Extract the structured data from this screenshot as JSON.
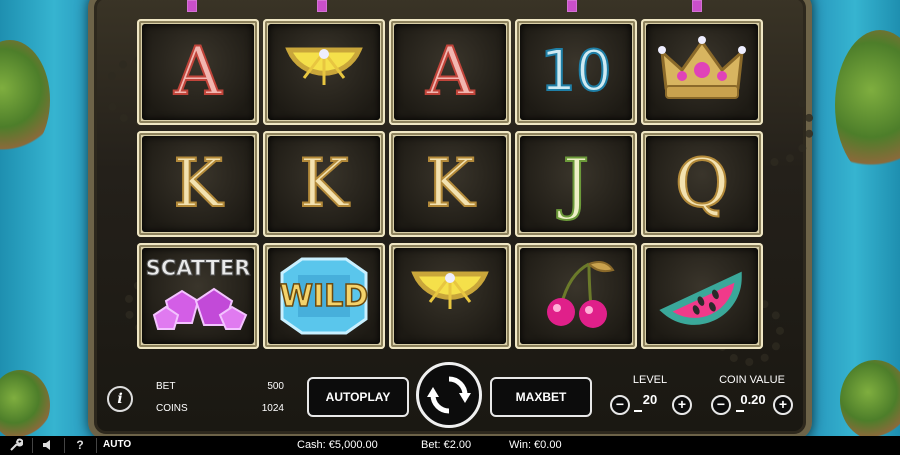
{
  "reels": [
    [
      {
        "symbol": "A",
        "style": "red"
      },
      {
        "symbol": "K",
        "style": "gold"
      },
      {
        "symbol": "SCATTER",
        "style": "scatter"
      }
    ],
    [
      {
        "symbol": "lemon",
        "style": "lemon"
      },
      {
        "symbol": "K",
        "style": "gold"
      },
      {
        "symbol": "WILD",
        "style": "wild"
      }
    ],
    [
      {
        "symbol": "A",
        "style": "red"
      },
      {
        "symbol": "K",
        "style": "gold"
      },
      {
        "symbol": "lemon",
        "style": "lemon"
      }
    ],
    [
      {
        "symbol": "10",
        "style": "blue"
      },
      {
        "symbol": "J",
        "style": "green"
      },
      {
        "symbol": "cherries",
        "style": "cherries"
      }
    ],
    [
      {
        "symbol": "crown",
        "style": "crown"
      },
      {
        "symbol": "Q",
        "style": "gold"
      },
      {
        "symbol": "watermelon",
        "style": "watermelon"
      }
    ]
  ],
  "stats": {
    "bet_label": "BET",
    "bet_value": "500",
    "coins_label": "COINS",
    "coins_value": "1024"
  },
  "buttons": {
    "info": "i",
    "autoplay": "AUTOPLAY",
    "maxbet": "MAXBET",
    "minus": "−",
    "plus": "+"
  },
  "level": {
    "label": "LEVEL",
    "value": "20"
  },
  "coin_value": {
    "label": "COIN VALUE",
    "value": "0.20"
  },
  "bottom_bar": {
    "auto_label": "AUTO",
    "help": "?",
    "cash": "Cash: €5,000.00",
    "bet": "Bet: €2.00",
    "win": "Win: €0.00"
  },
  "colors": {
    "sea": "#2a9cc0",
    "frame": "#6d6348",
    "cell_border": "#d9cfa8",
    "letter_red": "#c0443a",
    "letter_gold": "#b38a3a",
    "letter_blue": "#1f7fa6"
  }
}
